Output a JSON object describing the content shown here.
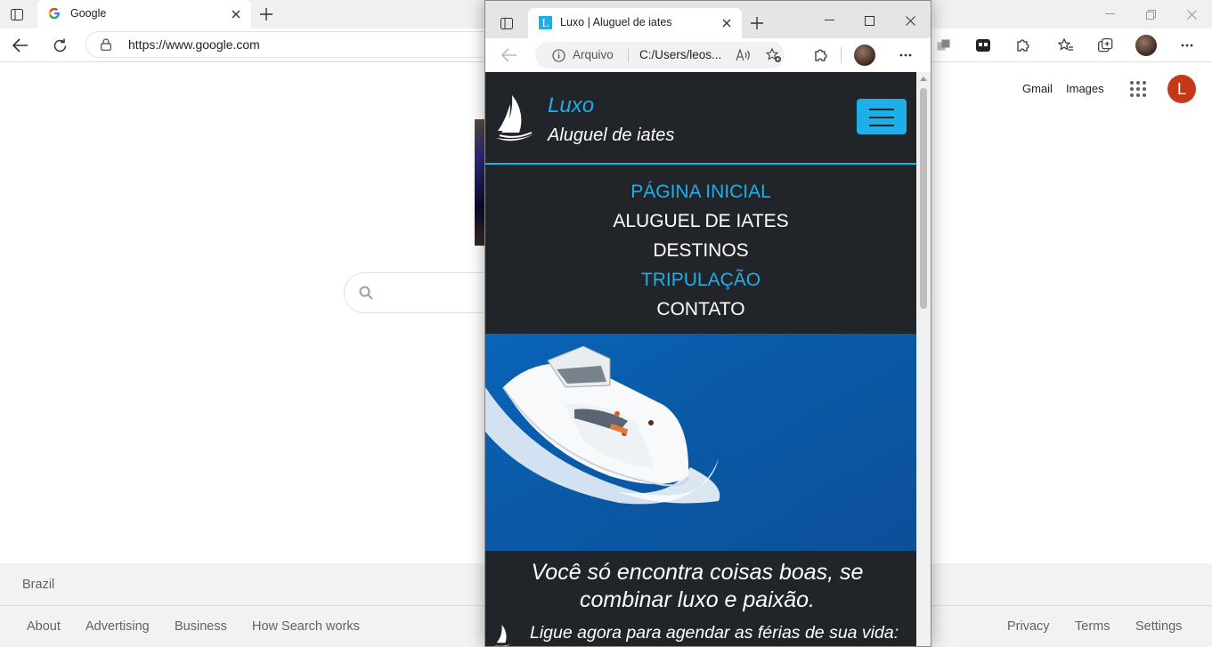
{
  "background_browser": {
    "tab_title": "Google",
    "address": "https://www.google.com"
  },
  "google": {
    "header_links": {
      "gmail": "Gmail",
      "images": "Images"
    },
    "avatar_letter": "L",
    "footer": {
      "country": "Brazil",
      "left_links": [
        "About",
        "Advertising",
        "Business",
        "How Search works"
      ],
      "right_links": [
        "Privacy",
        "Terms",
        "Settings"
      ]
    }
  },
  "front_browser": {
    "tab_title": "Luxo | Aluguel de iates",
    "tab_favicon_letter": "L",
    "address_label": "Arquivo",
    "address": "C:/Users/leos..."
  },
  "site": {
    "brand": "Luxo",
    "tagline": "Aluguel de iates",
    "menu": [
      {
        "label": "PÁGINA INICIAL",
        "color": "#1eaee8"
      },
      {
        "label": "ALUGUEL DE IATES",
        "color": "#ffffff"
      },
      {
        "label": "DESTINOS",
        "color": "#ffffff"
      },
      {
        "label": "TRIPULAÇÃO",
        "color": "#1eaee8"
      },
      {
        "label": "CONTATO",
        "color": "#ffffff"
      }
    ],
    "headline": "Você só encontra coisas boas, se combinar luxo e paixão.",
    "cta": "Ligue agora para agendar as férias de sua vida:"
  },
  "colors": {
    "accent": "#1eaee8",
    "dark": "#212529",
    "google_avatar": "#c5391a"
  }
}
